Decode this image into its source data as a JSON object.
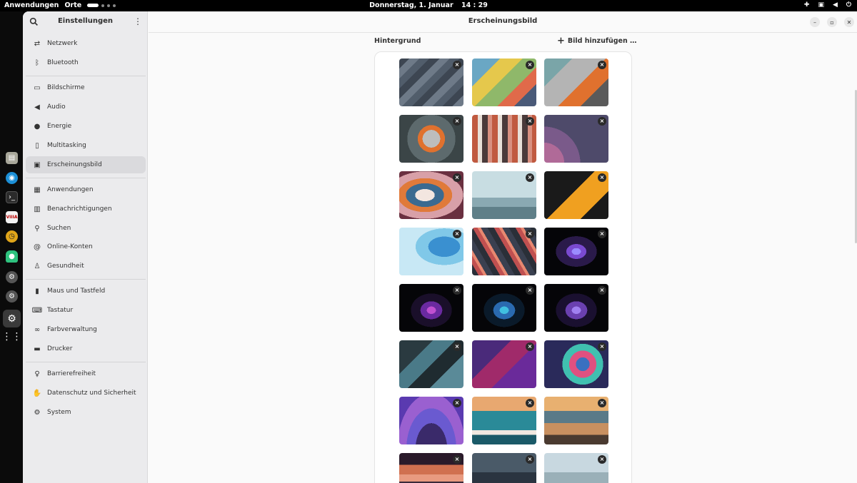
{
  "topbar": {
    "apps": "Anwendungen",
    "places": "Orte",
    "date": "Donnerstag, 1. Januar",
    "time": "14 : 29"
  },
  "sidebar": {
    "title": "Einstellungen",
    "items": [
      {
        "label": "Netzwerk",
        "icon": "network-icon"
      },
      {
        "label": "Bluetooth",
        "icon": "bluetooth-icon"
      },
      {
        "label": "Bildschirme",
        "icon": "display-icon"
      },
      {
        "label": "Audio",
        "icon": "speaker-icon"
      },
      {
        "label": "Energie",
        "icon": "power-icon"
      },
      {
        "label": "Multitasking",
        "icon": "multitasking-icon"
      },
      {
        "label": "Erscheinungsbild",
        "icon": "appearance-icon"
      },
      {
        "label": "Anwendungen",
        "icon": "apps-grid-icon"
      },
      {
        "label": "Benachrichtigungen",
        "icon": "notifications-icon"
      },
      {
        "label": "Suchen",
        "icon": "search-icon"
      },
      {
        "label": "Online-Konten",
        "icon": "at-icon"
      },
      {
        "label": "Gesundheit",
        "icon": "wellbeing-icon"
      },
      {
        "label": "Maus und Tastfeld",
        "icon": "mouse-icon"
      },
      {
        "label": "Tastatur",
        "icon": "keyboard-icon"
      },
      {
        "label": "Farbverwaltung",
        "icon": "color-icon"
      },
      {
        "label": "Drucker",
        "icon": "printer-icon"
      },
      {
        "label": "Barrierefreiheit",
        "icon": "accessibility-icon"
      },
      {
        "label": "Datenschutz und Sicherheit",
        "icon": "privacy-hand-icon"
      },
      {
        "label": "System",
        "icon": "gear-icon"
      }
    ]
  },
  "main": {
    "title": "Erscheinungsbild",
    "section": "Hintergrund",
    "add_button": "Bild hinzufügen …",
    "delete_glyph": "×"
  },
  "colors": {
    "accent": "#3584e4",
    "sidebar_bg": "#ebebed",
    "content_bg": "#fafafa"
  }
}
